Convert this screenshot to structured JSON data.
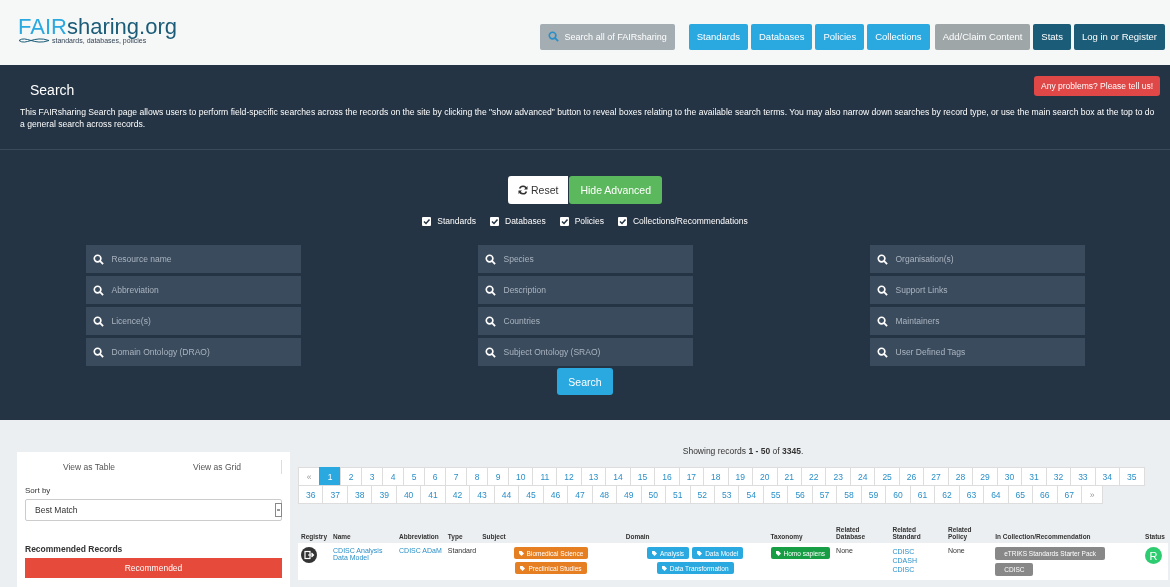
{
  "header": {
    "logo": {
      "accent": "FAIR",
      "rest": "sharing.org",
      "tagline": "standards, databases, policies"
    },
    "search": {
      "placeholder": "Search all of FAIRsharing"
    },
    "nav": [
      {
        "label": "Standards",
        "kind": "primary"
      },
      {
        "label": "Databases",
        "kind": "primary"
      },
      {
        "label": "Policies",
        "kind": "primary"
      },
      {
        "label": "Collections",
        "kind": "primary"
      },
      {
        "label": "Add/Claim Content",
        "kind": "muted"
      },
      {
        "label": "Stats",
        "kind": "dark"
      },
      {
        "label": "Log in or Register",
        "kind": "dark"
      }
    ]
  },
  "search_panel": {
    "title": "Search",
    "problem_button": "Any problems? Please tell us!",
    "description": "This FAIRsharing Search page allows users to perform field-specific searches across the records on the site by clicking the \"show advanced\" button to reveal boxes relating to the available search terms. You may also narrow down searches by record type, or use the main search box at the top to do a general search across records.",
    "reset_button": "Reset",
    "advanced_button": "Hide Advanced",
    "types": [
      {
        "label": "Standards",
        "checked": true
      },
      {
        "label": "Databases",
        "checked": true
      },
      {
        "label": "Policies",
        "checked": true
      },
      {
        "label": "Collections/Recommendations",
        "checked": true
      }
    ],
    "field_columns": [
      [
        "Resource name",
        "Abbreviation",
        "Licence(s)",
        "Domain Ontology (DRAO)"
      ],
      [
        "Species",
        "Description",
        "Countries",
        "Subject Ontology (SRAO)"
      ],
      [
        "Organisation(s)",
        "Support Links",
        "Maintainers",
        "User Defined Tags"
      ]
    ],
    "search_button": "Search"
  },
  "sidebar": {
    "view_tabs": [
      {
        "label": "View as Table",
        "selected": false
      },
      {
        "label": "View as Grid",
        "selected": false
      }
    ],
    "sort_label": "Sort by",
    "sort_value": "Best Match",
    "recommended_title": "Recommended Records",
    "recommended_button": "Recommended"
  },
  "results": {
    "summary": "Showing records **1 - 50** of **3345**.",
    "pagination": {
      "prev": "«",
      "next": "»",
      "pages": [
        {
          "label": "1",
          "selected": true
        },
        {
          "label": "2",
          "selected": false
        },
        {
          "label": "3",
          "selected": false
        },
        {
          "label": "4",
          "selected": false
        },
        {
          "label": "5",
          "selected": false
        },
        {
          "label": "6",
          "selected": false
        },
        {
          "label": "7",
          "selected": false
        },
        {
          "label": "8",
          "selected": false
        },
        {
          "label": "9",
          "selected": false
        },
        {
          "label": "10",
          "selected": false
        },
        {
          "label": "11",
          "selected": false
        },
        {
          "label": "12",
          "selected": false
        },
        {
          "label": "13",
          "selected": false
        },
        {
          "label": "14",
          "selected": false
        },
        {
          "label": "15",
          "selected": false
        },
        {
          "label": "16",
          "selected": false
        },
        {
          "label": "17",
          "selected": false
        },
        {
          "label": "18",
          "selected": false
        },
        {
          "label": "19",
          "selected": false
        },
        {
          "label": "20",
          "selected": false
        },
        {
          "label": "21",
          "selected": false
        },
        {
          "label": "22",
          "selected": false
        },
        {
          "label": "23",
          "selected": false
        },
        {
          "label": "24",
          "selected": false
        },
        {
          "label": "25",
          "selected": false
        },
        {
          "label": "26",
          "selected": false
        },
        {
          "label": "27",
          "selected": false
        },
        {
          "label": "28",
          "selected": false
        },
        {
          "label": "29",
          "selected": false
        },
        {
          "label": "30",
          "selected": false
        },
        {
          "label": "31",
          "selected": false
        },
        {
          "label": "32",
          "selected": false
        },
        {
          "label": "33",
          "selected": false
        },
        {
          "label": "34",
          "selected": false
        },
        {
          "label": "35",
          "selected": false
        },
        {
          "label": "36",
          "selected": false
        },
        {
          "label": "37",
          "selected": false
        },
        {
          "label": "38",
          "selected": false
        },
        {
          "label": "39",
          "selected": false
        },
        {
          "label": "40",
          "selected": false
        },
        {
          "label": "41",
          "selected": false
        },
        {
          "label": "42",
          "selected": false
        },
        {
          "label": "43",
          "selected": false
        },
        {
          "label": "44",
          "selected": false
        },
        {
          "label": "45",
          "selected": false
        },
        {
          "label": "46",
          "selected": false
        },
        {
          "label": "47",
          "selected": false
        },
        {
          "label": "48",
          "selected": false
        },
        {
          "label": "49",
          "selected": false
        },
        {
          "label": "50",
          "selected": false
        },
        {
          "label": "51",
          "selected": false
        },
        {
          "label": "52",
          "selected": false
        },
        {
          "label": "53",
          "selected": false
        },
        {
          "label": "54",
          "selected": false
        },
        {
          "label": "55",
          "selected": false
        },
        {
          "label": "56",
          "selected": false
        },
        {
          "label": "57",
          "selected": false
        },
        {
          "label": "58",
          "selected": false
        },
        {
          "label": "59",
          "selected": false
        },
        {
          "label": "60",
          "selected": false
        },
        {
          "label": "61",
          "selected": false
        },
        {
          "label": "62",
          "selected": false
        },
        {
          "label": "63",
          "selected": false
        },
        {
          "label": "64",
          "selected": false
        },
        {
          "label": "65",
          "selected": false
        },
        {
          "label": "66",
          "selected": false
        },
        {
          "label": "67",
          "selected": false
        }
      ]
    },
    "table": {
      "columns": [
        "Registry",
        "Name",
        "Abbreviation",
        "Type",
        "Subject",
        "Domain",
        "Taxonomy",
        "Related Database",
        "Related Standard",
        "Related Policy",
        "In Collection/Recommendation",
        "Status"
      ],
      "rows": [
        {
          "name": "CDISC Analysis Data Model",
          "abbreviation": "CDISC ADaM",
          "type": "Standard",
          "subject": [
            "Biomedical Science",
            "Preclinical Studies"
          ],
          "domain": [
            "Analysis",
            "Data Model",
            "Data Transformation"
          ],
          "taxonomy": [
            "Homo sapiens"
          ],
          "related_database": "None",
          "related_standard": [
            "CDISC",
            "CDASH",
            "CDISC"
          ],
          "related_policy": "None",
          "collections": [
            "eTRIKS Standards Starter Pack",
            "CDISC"
          ],
          "status": "R"
        }
      ]
    }
  }
}
